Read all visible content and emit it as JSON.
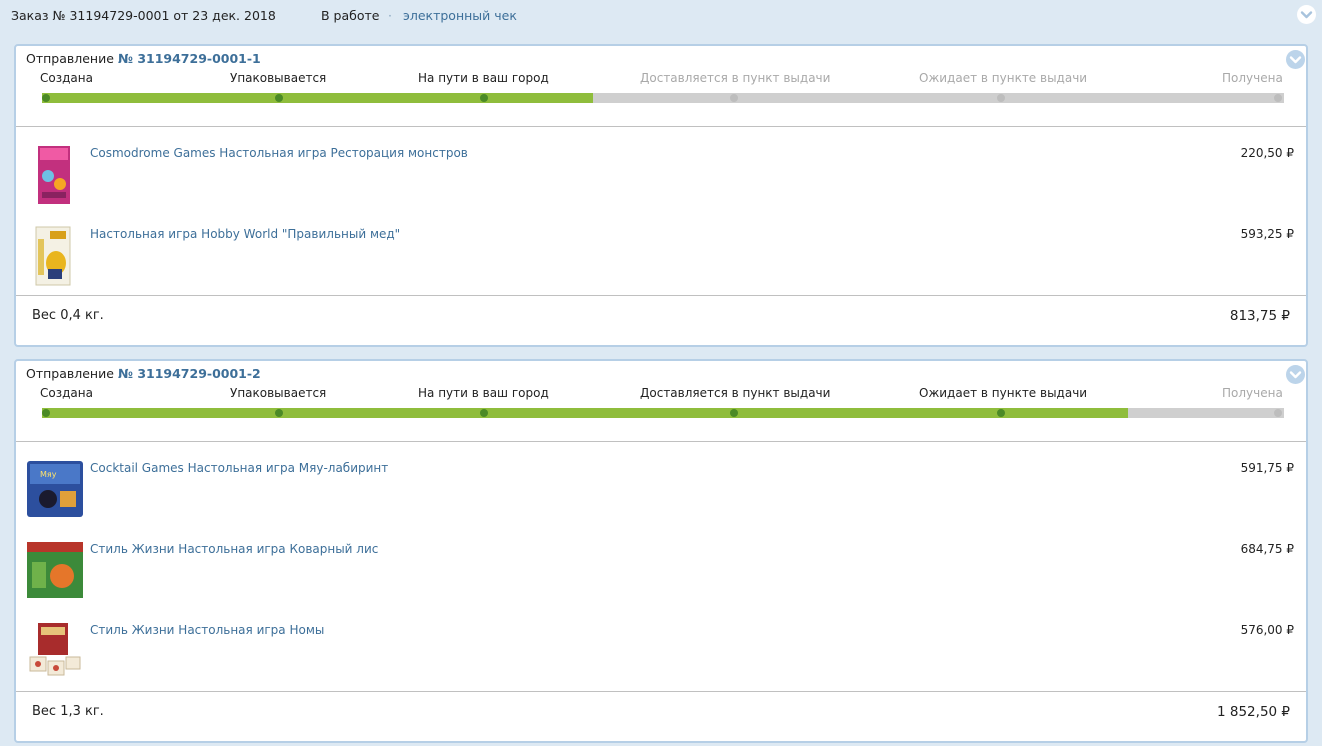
{
  "order": {
    "title": "Заказ  № 31194729-0001 от  23 дек. 2018",
    "status": "В работе",
    "separator": "·",
    "receipt_link": "электронный чек"
  },
  "currency": "₽",
  "shipments": [
    {
      "label": "Отправление",
      "number": "№ 31194729-0001-1",
      "stages": [
        {
          "label": "Создана",
          "done": true
        },
        {
          "label": "Упаковывается",
          "done": true
        },
        {
          "label": "На пути в ваш город",
          "done": true
        },
        {
          "label": "Доставляется в пункт выдачи",
          "done": false
        },
        {
          "label": "Ожидает в пункте выдачи",
          "done": false
        },
        {
          "label": "Получена",
          "done": false
        }
      ],
      "items": [
        {
          "title": "Cosmodrome Games Настольная игра Ресторация монстров",
          "price": "220,50 ₽",
          "thumb": "box-pink-icon"
        },
        {
          "title": "Настольная игра Hobby World \"Правильный мед\"",
          "price": "593,25 ₽",
          "thumb": "box-yellow-icon"
        }
      ],
      "weight": "Вес 0,4 кг.",
      "total": "813,75  ₽"
    },
    {
      "label": "Отправление",
      "number": "№ 31194729-0001-2",
      "stages": [
        {
          "label": "Создана",
          "done": true
        },
        {
          "label": "Упаковывается",
          "done": true
        },
        {
          "label": "На пути в ваш город",
          "done": true
        },
        {
          "label": "Доставляется в пункт выдачи",
          "done": true
        },
        {
          "label": "Ожидает в пункте выдачи",
          "done": true
        },
        {
          "label": "Получена",
          "done": false
        }
      ],
      "items": [
        {
          "title": "Cocktail Games Настольная игра Мяу-лабиринт",
          "price": "591,75 ₽",
          "thumb": "box-blue-icon"
        },
        {
          "title": "Стиль Жизни Настольная игра Коварный лис",
          "price": "684,75 ₽",
          "thumb": "box-green-icon"
        },
        {
          "title": "Стиль Жизни Настольная игра Номы",
          "price": "576,00 ₽",
          "thumb": "box-red-icon"
        }
      ],
      "weight": "Вес 1,3 кг.",
      "total": "1 852,50  ₽"
    }
  ]
}
